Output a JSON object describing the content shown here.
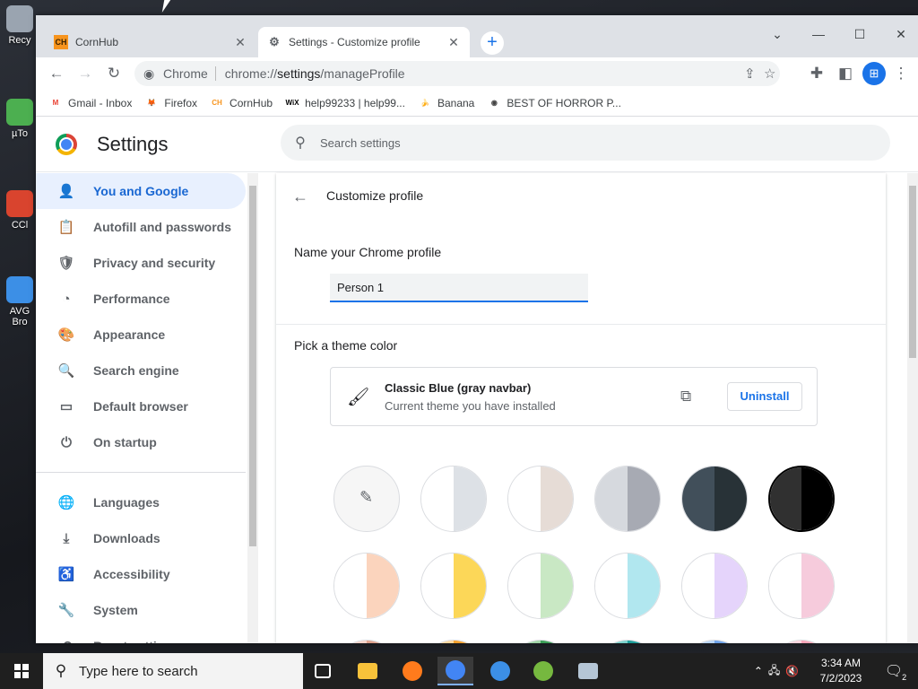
{
  "desktop": {
    "icons": [
      {
        "label": "Recy",
        "color": "#9aa4b0",
        "icon": "recycle-bin-icon"
      },
      {
        "label": "µTo",
        "color": "#4caf50",
        "icon": "utorrent-icon"
      },
      {
        "label": "CCl",
        "color": "#d9442e",
        "icon": "ccleaner-icon"
      },
      {
        "label": "AVG Bro",
        "color": "#3c8fe6",
        "icon": "avg-browser-icon"
      }
    ]
  },
  "browser": {
    "tabs": [
      {
        "title": "CornHub",
        "favicon": "CH",
        "close": "✕"
      },
      {
        "title": "Settings - Customize profile",
        "favicon": "⚙",
        "close": "✕"
      }
    ],
    "new_tab": "+",
    "window_controls": {
      "tab_search": "⌄",
      "minimize": "—",
      "maximize": "☐",
      "close": "✕"
    },
    "omnibox": {
      "chip": "Chrome",
      "url_prefix": "chrome://",
      "url_host": "settings",
      "url_path": "/manageProfile"
    },
    "bookmarks": [
      {
        "label": "Gmail - Inbox",
        "badge": "M",
        "color": "#ea4335",
        "icon": "gmail-icon"
      },
      {
        "label": "Firefox",
        "badge": "🦊",
        "color": "#e33a1d",
        "icon": "firefox-icon"
      },
      {
        "label": "CornHub",
        "badge": "CH",
        "color": "#f7941d",
        "icon": "cornhub-icon"
      },
      {
        "label": "help99233 | help99...",
        "badge": "WiX",
        "color": "#000000",
        "icon": "wix-icon"
      },
      {
        "label": "Banana",
        "badge": "🍌",
        "color": "#c8d63b",
        "icon": "banana-icon"
      },
      {
        "label": "BEST OF HORROR P...",
        "badge": "◉",
        "color": "#444444",
        "icon": "globe-icon"
      }
    ]
  },
  "settings": {
    "title": "Settings",
    "search_placeholder": "Search settings",
    "nav": [
      {
        "label": "You and Google",
        "icon": "person-icon",
        "glyph": "👤",
        "selected": true
      },
      {
        "label": "Autofill and passwords",
        "icon": "clipboard-icon",
        "glyph": "📋"
      },
      {
        "label": "Privacy and security",
        "icon": "shield-icon",
        "glyph": "🛡"
      },
      {
        "label": "Performance",
        "icon": "speedometer-icon",
        "glyph": "◔"
      },
      {
        "label": "Appearance",
        "icon": "palette-icon",
        "glyph": "🎨"
      },
      {
        "label": "Search engine",
        "icon": "search-icon",
        "glyph": "🔍"
      },
      {
        "label": "Default browser",
        "icon": "browser-window-icon",
        "glyph": "▭"
      },
      {
        "label": "On startup",
        "icon": "power-icon",
        "glyph": "⏻"
      }
    ],
    "nav2": [
      {
        "label": "Languages",
        "icon": "globe-icon",
        "glyph": "🌐"
      },
      {
        "label": "Downloads",
        "icon": "download-icon",
        "glyph": "⤓"
      },
      {
        "label": "Accessibility",
        "icon": "accessibility-icon",
        "glyph": "♿"
      },
      {
        "label": "System",
        "icon": "wrench-icon",
        "glyph": "🔧"
      },
      {
        "label": "Reset settings",
        "icon": "reset-icon",
        "glyph": "⟲"
      }
    ],
    "page_title": "Customize profile",
    "name_label": "Name your Chrome profile",
    "name_value": "Person 1",
    "theme_label": "Pick a theme color",
    "theme_name": "Classic Blue (gray navbar)",
    "theme_desc": "Current theme you have installed",
    "uninstall": "Uninstall",
    "swatches": [
      [
        "#f6f6f6",
        "#f6f6f6"
      ],
      [
        "#ffffff",
        "#dde1e6"
      ],
      [
        "#ffffff",
        "#e6dcd6"
      ],
      [
        "#d6d9de",
        "#a7aab3"
      ],
      [
        "#414f5a",
        "#283237"
      ],
      [
        "#303030",
        "#000000"
      ],
      [
        "#ffffff",
        "#fbd4bd"
      ],
      [
        "#ffffff",
        "#fcd758"
      ],
      [
        "#ffffff",
        "#c9e8c4"
      ],
      [
        "#ffffff",
        "#b1e7ef"
      ],
      [
        "#ffffff",
        "#e5d4fb"
      ],
      [
        "#ffffff",
        "#f6cbdc"
      ],
      [
        "#f3d2c8",
        "#dda08c"
      ],
      [
        "#ffd79e",
        "#f29f2c"
      ],
      [
        "#9fd3a6",
        "#3b9e57"
      ],
      [
        "#7cd1cc",
        "#1c9d9a"
      ],
      [
        "#b9d6f9",
        "#6da2ea"
      ],
      [
        "#ffd5de",
        "#f6a4b8"
      ]
    ]
  },
  "taskbar": {
    "search_placeholder": "Type here to search",
    "apps": [
      {
        "icon": "task-view-icon",
        "color": "#1f1f1f"
      },
      {
        "icon": "file-explorer-icon",
        "color": "#f8c23a"
      },
      {
        "icon": "firefox-icon",
        "color": "#ff7b1c"
      },
      {
        "icon": "chrome-icon",
        "color": "#4285f4",
        "active": true
      },
      {
        "icon": "brave-icon",
        "color": "#3c8fe6"
      },
      {
        "icon": "utorrent-icon",
        "color": "#76b83f"
      },
      {
        "icon": "keyboard-app-icon",
        "color": "#b5c6d6"
      }
    ],
    "time": "3:34 AM",
    "date": "7/2/2023",
    "notification_count": "2"
  }
}
